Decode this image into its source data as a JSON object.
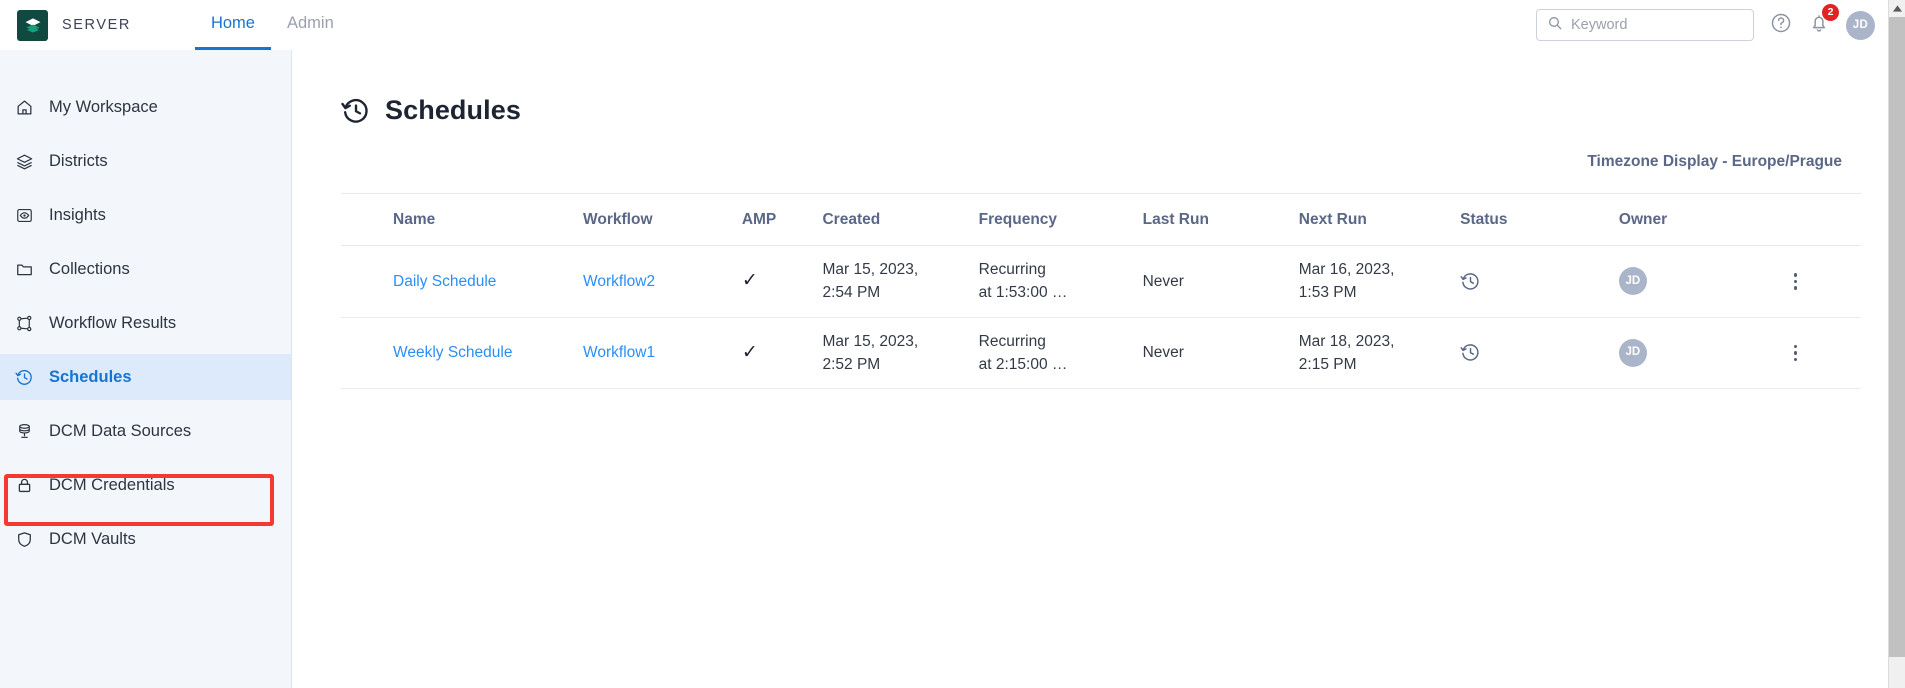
{
  "header": {
    "brand_name": "SERVER",
    "logo_icon": "layers-stack-icon",
    "tabs": [
      {
        "label": "Home",
        "active": true
      },
      {
        "label": "Admin",
        "active": false
      }
    ],
    "search": {
      "placeholder": "Keyword",
      "value": "",
      "icon": "search-icon"
    },
    "help_icon": "question-circle-icon",
    "notifications": {
      "icon": "bell-icon",
      "count": "2",
      "badge_color": "#e02424"
    },
    "avatar": {
      "initials": "JD",
      "color": "#aab5ca"
    }
  },
  "sidebar": {
    "items": [
      {
        "label": "My Workspace",
        "icon": "home-icon",
        "selected": false
      },
      {
        "label": "Districts",
        "icon": "layers-icon",
        "selected": false
      },
      {
        "label": "Insights",
        "icon": "eye-square-icon",
        "selected": false
      },
      {
        "label": "Collections",
        "icon": "folder-icon",
        "selected": false
      },
      {
        "label": "Workflow Results",
        "icon": "workflow-nodes-icon",
        "selected": false
      },
      {
        "label": "Schedules",
        "icon": "history-clock-icon",
        "selected": true
      },
      {
        "label": "DCM Data Sources",
        "icon": "database-icon",
        "selected": false
      },
      {
        "label": "DCM Credentials",
        "icon": "lock-icon",
        "selected": false
      },
      {
        "label": "DCM Vaults",
        "icon": "shield-icon",
        "selected": false
      }
    ],
    "highlight_color": "#f4392e",
    "selected_bg": "#dceafb",
    "selected_fg": "#1675d1"
  },
  "page": {
    "title": "Schedules",
    "title_icon": "history-clock-icon",
    "timezone_label": "Timezone Display - Europe/Prague"
  },
  "table": {
    "columns": [
      "Name",
      "Workflow",
      "AMP",
      "Created",
      "Frequency",
      "Last Run",
      "Next Run",
      "Status",
      "Owner"
    ],
    "rows": [
      {
        "name": "Daily Schedule",
        "workflow": "Workflow2",
        "amp": "✓",
        "created": "Mar 15, 2023,\n2:54 PM",
        "frequency": "Recurring\nat 1:53:00 …",
        "last_run": "Never",
        "next_run": "Mar 16, 2023,\n1:53 PM",
        "status_icon": "history-clock-icon",
        "owner_initials": "JD",
        "menu_icon": "kebab-menu-icon"
      },
      {
        "name": "Weekly Schedule",
        "workflow": "Workflow1",
        "amp": "✓",
        "created": "Mar 15, 2023,\n2:52 PM",
        "frequency": "Recurring\nat 2:15:00 …",
        "last_run": "Never",
        "next_run": "Mar 18, 2023,\n2:15 PM",
        "status_icon": "history-clock-icon",
        "owner_initials": "JD",
        "menu_icon": "kebab-menu-icon"
      }
    ]
  }
}
